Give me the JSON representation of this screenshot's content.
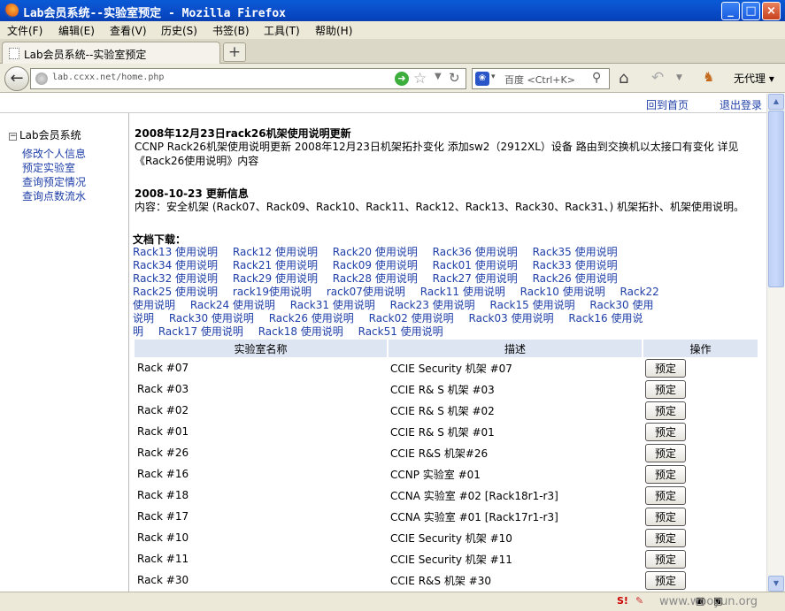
{
  "window": {
    "title": "Lab会员系统--实验室预定 - Mozilla Firefox",
    "min": "_",
    "max": "□",
    "close": "×"
  },
  "menu": [
    "文件(F)",
    "编辑(E)",
    "查看(V)",
    "历史(S)",
    "书签(B)",
    "工具(T)",
    "帮助(H)"
  ],
  "tab": {
    "label": "Lab会员系统--实验室预定",
    "new": "+"
  },
  "nav": {
    "url": "lab.ccxx.net/home.php",
    "search_engine": "百度",
    "search_placeholder": "百度 <Ctrl+K>",
    "proxy": "无代理"
  },
  "topnav": {
    "home": "回到首页",
    "logout": "退出登录"
  },
  "sidebar": {
    "root": "Lab会员系统",
    "items": [
      "修改个人信息",
      "预定实验室",
      "查询预定情况",
      "查询点数流水"
    ]
  },
  "news": [
    {
      "title": "2008年12月23日rack26机架使用说明更新",
      "body": "CCNP Rack26机架使用说明更新 2008年12月23日机架拓扑变化 添加sw2（2912XL）设备 路由到交换机以太接口有变化 详见《Rack26使用说明》内容"
    },
    {
      "title": "2008-10-23 更新信息",
      "body": "内容：安全机架 (Rack07、Rack09、Rack10、Rack11、Rack12、Rack13、Rack30、Rack31、) 机架拓扑、机架使用说明。"
    }
  ],
  "downloads": {
    "header": "文档下载：",
    "links": [
      "Rack13 使用说明",
      "Rack12 使用说明",
      "Rack20 使用说明",
      "Rack36 使用说明",
      "Rack35 使用说明",
      "Rack34 使用说明",
      "Rack21 使用说明",
      "Rack09 使用说明",
      "Rack01 使用说明",
      "Rack33 使用说明",
      "Rack32 使用说明",
      "Rack29 使用说明",
      "Rack28 使用说明",
      "Rack27 使用说明",
      "Rack26 使用说明",
      "Rack25 使用说明",
      "rack19使用说明",
      "rack07使用说明",
      "Rack11 使用说明",
      "Rack10 使用说明",
      "Rack22 使用说明",
      "Rack24 使用说明",
      "Rack31 使用说明",
      "Rack23 使用说明",
      "Rack15 使用说明",
      "Rack30 使用说明",
      "Rack30 使用说明",
      "Rack26 使用说明",
      "Rack02 使用说明",
      "Rack03 使用说明",
      "Rack16 使用说明",
      "Rack17 使用说明",
      "Rack18 使用说明",
      "Rack51 使用说明"
    ]
  },
  "table": {
    "headers": [
      "实验室名称",
      "描述",
      "操作"
    ],
    "button": "预定",
    "rows": [
      {
        "name": "Rack #07",
        "desc": "CCIE Security 机架 #07"
      },
      {
        "name": "Rack #03",
        "desc": "CCIE R& S 机架 #03"
      },
      {
        "name": "Rack #02",
        "desc": "CCIE R& S 机架 #02"
      },
      {
        "name": "Rack #01",
        "desc": "CCIE R& S 机架 #01"
      },
      {
        "name": "Rack #26",
        "desc": "CCIE R&S 机架#26"
      },
      {
        "name": "Rack #16",
        "desc": "CCNP 实验室 #01"
      },
      {
        "name": "Rack #18",
        "desc": "CCNA 实验室 #02 [Rack18r1-r3]"
      },
      {
        "name": "Rack #17",
        "desc": "CCNA 实验室 #01 [Rack17r1-r3]"
      },
      {
        "name": "Rack #10",
        "desc": "CCIE Security 机架 #10"
      },
      {
        "name": "Rack #11",
        "desc": "CCIE Security 机架 #11"
      },
      {
        "name": "Rack #30",
        "desc": "CCIE R&S 机架 #30"
      }
    ]
  },
  "status": {
    "watermark": "www.wooyun.org"
  },
  "colors": {
    "link": "#1f3fa8",
    "table_header": "#dde4f2",
    "titlebar": "#0a4fcc"
  }
}
